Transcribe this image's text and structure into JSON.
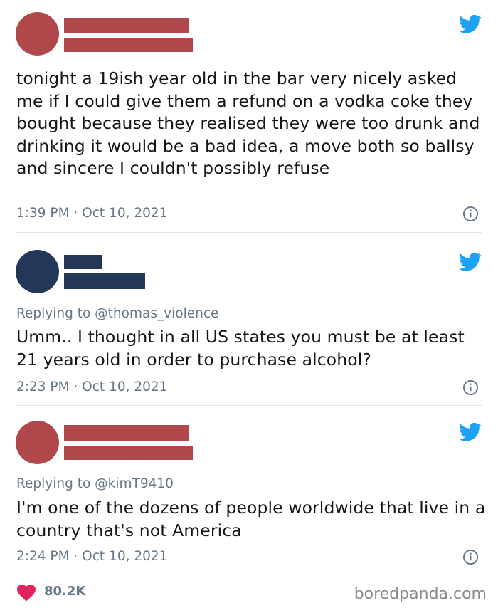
{
  "colors": {
    "redact_red": "#b0474a",
    "redact_navy": "#233858",
    "twitter_blue": "#1da1f2",
    "heart_pink": "#e0245e",
    "muted": "#657786"
  },
  "tweets": [
    {
      "text": "tonight a 19ish year old in the bar very nicely asked me if I could give them a refund on a vodka coke they bought because they realised they were too drunk and drinking it would be a bad idea, a move both so ballsy and sincere I couldn't possibly refuse",
      "timestamp": "1:39 PM · Oct 10, 2021"
    },
    {
      "replying_to": "Replying to @thomas_violence",
      "text": "Umm.. I thought in all US states you must be at least 21 years old in order to purchase alcohol?",
      "timestamp": "2:23 PM · Oct 10, 2021"
    },
    {
      "replying_to": "Replying to @kimT9410",
      "text": "I'm one of the dozens of people worldwide that live in a country that's not America",
      "timestamp": "2:24 PM · Oct 10, 2021"
    }
  ],
  "footer": {
    "likes": "80.2K",
    "watermark": "boredpanda.com",
    "heart_icon": "heart-icon"
  },
  "icons": {
    "bird": "twitter-bird-icon",
    "info": "info-icon"
  }
}
